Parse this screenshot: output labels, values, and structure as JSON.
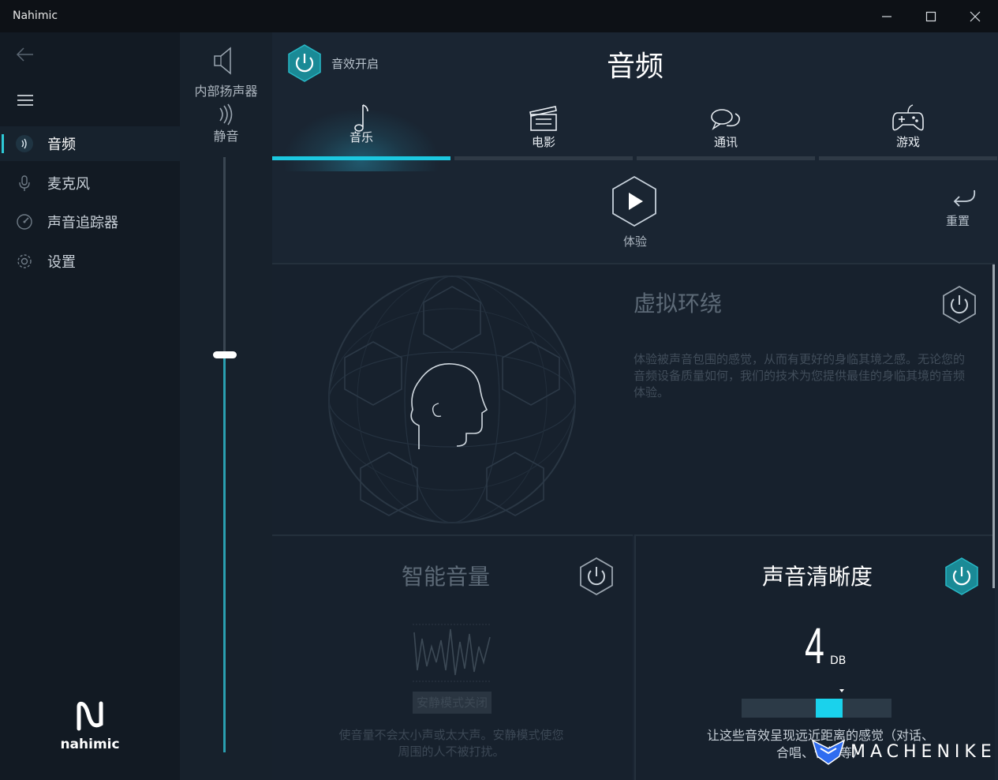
{
  "app": {
    "title": "Nahimic"
  },
  "window": {
    "minimize": "—",
    "maximize": "☐",
    "close": "✕"
  },
  "nav": {
    "items": [
      {
        "label": "音频",
        "icon": "audio-wave-icon"
      },
      {
        "label": "麦克风",
        "icon": "microphone-icon"
      },
      {
        "label": "声音追踪器",
        "icon": "sound-tracker-icon"
      },
      {
        "label": "设置",
        "icon": "gear-icon"
      }
    ],
    "logo_text": "nahimic"
  },
  "volume": {
    "device": "内部扬声器",
    "mute": "静音",
    "level": 0.67
  },
  "header": {
    "effects_label": "音效开启",
    "title": "音频"
  },
  "tabs": [
    {
      "label": "音乐",
      "icon": "music-note-icon",
      "active": true
    },
    {
      "label": "电影",
      "icon": "clapperboard-icon",
      "active": false
    },
    {
      "label": "通讯",
      "icon": "chat-bubbles-icon",
      "active": false
    },
    {
      "label": "游戏",
      "icon": "gamepad-icon",
      "active": false
    }
  ],
  "toolbar": {
    "play_label": "体验",
    "reset_label": "重置"
  },
  "virtual_surround": {
    "title": "虚拟环绕",
    "description": "体验被声音包围的感觉，从而有更好的身临其境之感。无论您的音频设备质量如何，我们的技术为您提供最佳的身临其境的音频体验。",
    "enabled": false
  },
  "smart_volume": {
    "title": "智能音量",
    "quiet_mode_label": "安静模式关闭",
    "description": "使音量不会太小声或太大声。安静模式使您周围的人不被打扰。",
    "enabled": false
  },
  "clarity": {
    "title": "声音清晰度",
    "value": "4",
    "unit": "DB",
    "description": "让这些音效呈现远近距离的感觉（对话、合唱、长笛等）",
    "enabled": true,
    "level": 0.55
  },
  "watermark": {
    "text": "MACHENIKE"
  },
  "colors": {
    "accent": "#1cc8e0",
    "background": "#1a2532",
    "nav": "#121a23"
  }
}
